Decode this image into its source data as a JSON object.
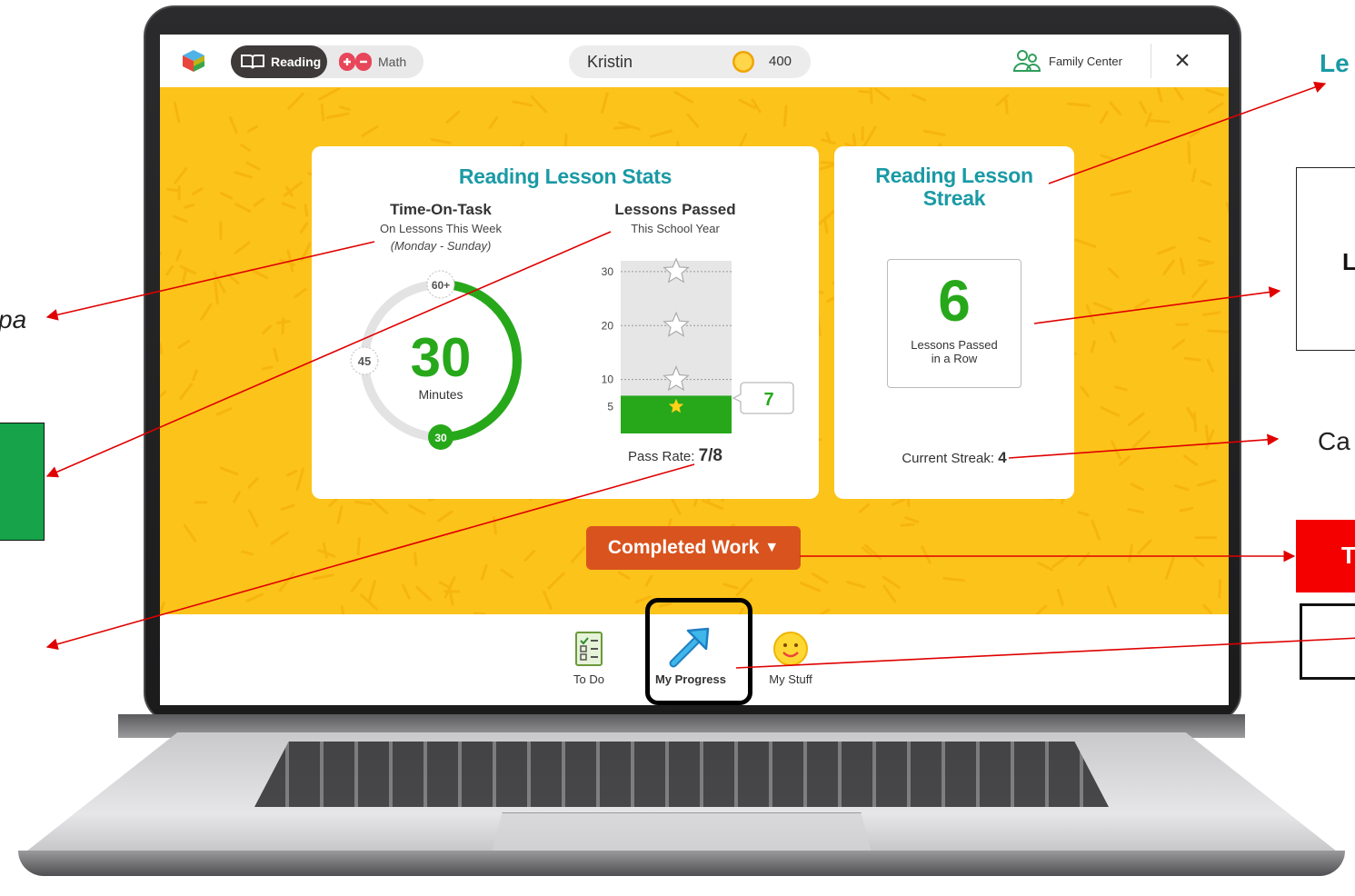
{
  "colors": {
    "yellow": "#fcc31a",
    "teal": "#1a9aa5",
    "green": "#27a81b",
    "orange_button": "#d9531e",
    "annotation_red": "#e00000",
    "annotation_green_box": "#16a34a"
  },
  "topbar": {
    "reading_tab": "Reading",
    "math_tab": "Math",
    "student_name": "Kristin",
    "coins": "400",
    "family_center": "Family Center",
    "close": "×"
  },
  "stats_card": {
    "title": "Reading Lesson Stats",
    "time_on_task": {
      "heading": "Time-On-Task",
      "sub1": "On Lessons This Week",
      "sub2": "(Monday - Sunday)",
      "minutes_value": 30,
      "minutes_label": "Minutes",
      "gauge_max": 60,
      "marker_60": "60+",
      "marker_45": "45",
      "marker_30": "30"
    },
    "lessons_passed": {
      "heading": "Lessons Passed",
      "sub": "This School Year",
      "ticks": [
        "30",
        "20",
        "10",
        "5"
      ],
      "value": 7,
      "callout": "7",
      "pass_rate_label": "Pass Rate:",
      "pass_rate_value": "7/8"
    }
  },
  "streak_card": {
    "title_line1": "Reading Lesson",
    "title_line2": "Streak",
    "best_value": "6",
    "best_label_line1": "Lessons Passed",
    "best_label_line2": "in a Row",
    "current_label": "Current Streak:",
    "current_value": "4"
  },
  "completed_work_button": "Completed Work",
  "nav": {
    "todo": "To Do",
    "my_progress": "My Progress",
    "my_stuff": "My Stuff"
  },
  "annotations": {
    "right_top": "Le",
    "right_box": "L",
    "right_mid": "Ca",
    "right_red": "T",
    "left_italic": "pa"
  }
}
